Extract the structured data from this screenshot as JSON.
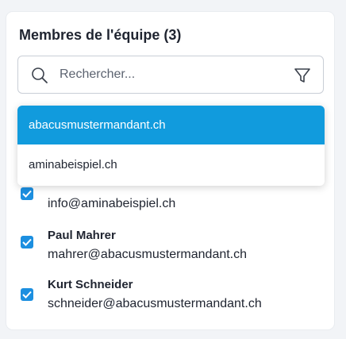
{
  "team": {
    "title": "Membres de l'équipe (3)"
  },
  "search": {
    "placeholder": "Rechercher...",
    "icon": "search-icon",
    "filter_icon": "filter-icon"
  },
  "dropdown": {
    "options": [
      {
        "label": "abacusmustermandant.ch",
        "selected": true
      },
      {
        "label": "aminabeispiel.ch",
        "selected": false
      }
    ]
  },
  "members": [
    {
      "name": "",
      "email": "info@aminabeispiel.ch",
      "checked": true
    },
    {
      "name": "Paul Mahrer",
      "email": "mahrer@abacusmustermandant.ch",
      "checked": true
    },
    {
      "name": "Kurt Schneider",
      "email": "schneider@abacusmustermandant.ch",
      "checked": true
    }
  ],
  "colors": {
    "accent": "#1c8fe0",
    "selected_option": "#119bdd",
    "text": "#1f2430"
  }
}
